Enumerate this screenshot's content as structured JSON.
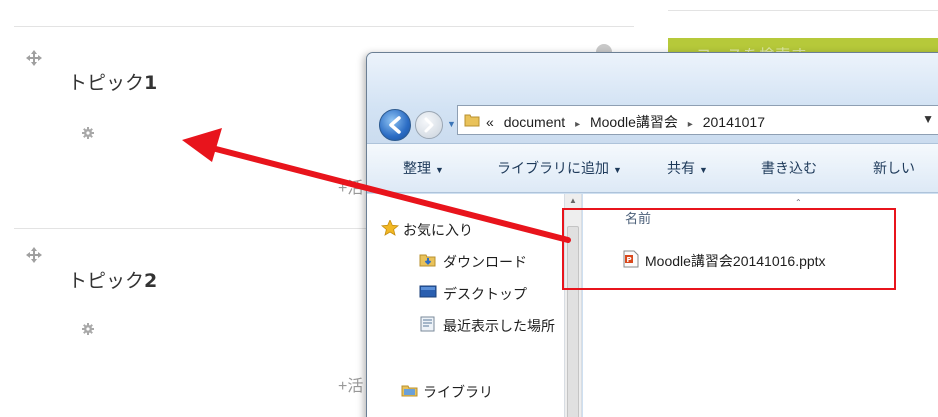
{
  "moodle": {
    "topics": [
      {
        "title": "トピック",
        "number": "1"
      },
      {
        "title": "トピック",
        "number": "2"
      }
    ],
    "add_activity_glyph": "+",
    "add_activity_partial": "活",
    "banner_text": "コースを検索す",
    "banner_color": "#b6c93a"
  },
  "explorer": {
    "address": {
      "overflow": "«",
      "crumbs": [
        "document",
        "Moodle講習会",
        "20141017"
      ],
      "separator": "▸"
    },
    "toolbar": [
      {
        "label": "整理",
        "caret": "▼"
      },
      {
        "label": "ライブラリに追加",
        "caret": "▼"
      },
      {
        "label": "共有",
        "caret": "▼"
      },
      {
        "label": "書き込む",
        "caret": ""
      },
      {
        "label": "新しい",
        "caret": ""
      }
    ],
    "nav": {
      "favorites": "お気に入り",
      "items": [
        "ダウンロード",
        "デスクトップ",
        "最近表示した場所"
      ],
      "library": "ライブラリ"
    },
    "files": {
      "column_name": "名前",
      "items": [
        {
          "name": "Moodle講習会20141016.pptx",
          "type": "pptx"
        }
      ]
    }
  },
  "colors": {
    "annotation_red": "#e8141c",
    "accent_blue": "#2b6cc4"
  }
}
